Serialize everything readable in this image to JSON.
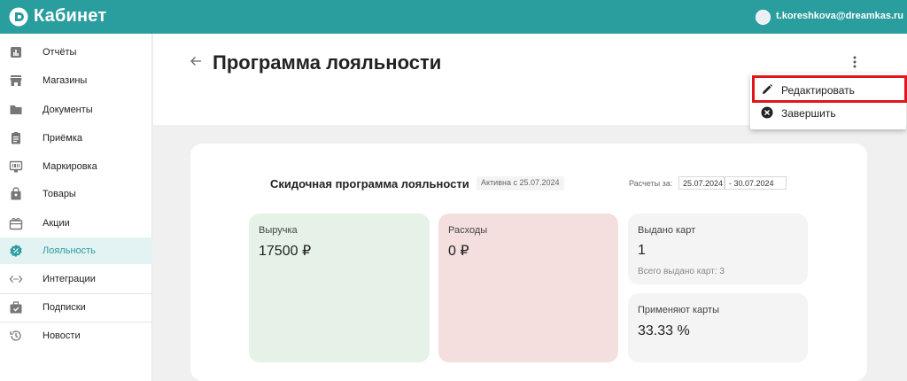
{
  "app": {
    "brand": "Кабинет",
    "user_email": "t.koreshkova@dreamkas.ru",
    "accent": "#2a9d9e"
  },
  "sidebar": {
    "items": [
      {
        "label": "Отчёты",
        "icon": "bar-chart-icon",
        "active": false
      },
      {
        "label": "Магазины",
        "icon": "store-icon",
        "active": false
      },
      {
        "label": "Документы",
        "icon": "folder-icon",
        "active": false
      },
      {
        "label": "Приёмка",
        "icon": "clipboard-icon",
        "active": false
      },
      {
        "label": "Маркировка",
        "icon": "barcode-scanner-icon",
        "active": false
      },
      {
        "label": "Товары",
        "icon": "shopping-bag-icon",
        "active": false
      },
      {
        "label": "Акции",
        "icon": "gift-icon",
        "active": false
      },
      {
        "label": "Лояльность",
        "icon": "badge-percent-icon",
        "active": true
      },
      {
        "label": "Интеграции",
        "icon": "code-arrows-icon",
        "active": false
      },
      {
        "label": "Подписки",
        "icon": "briefcase-check-icon",
        "active": false
      },
      {
        "label": "Новости",
        "icon": "history-icon",
        "active": false
      }
    ]
  },
  "page": {
    "title": "Программа лояльности"
  },
  "program": {
    "title": "Скидочная программа лояльности",
    "status": "Активна с 25.07.2024",
    "calc_label": "Расчеты за:",
    "date_from": "25.07.2024",
    "date_to": "- 30.07.2024"
  },
  "tiles": {
    "revenue": {
      "label": "Выручка",
      "value": "17500 ₽"
    },
    "expenses": {
      "label": "Расходы",
      "value": "0 ₽"
    },
    "cards_issued": {
      "label": "Выдано карт",
      "value": "1",
      "sub": "Всего выдано карт: 3"
    },
    "cards_usage": {
      "label": "Применяют карты",
      "value": "33.33 %"
    }
  },
  "menu": {
    "edit_label": "Редактировать",
    "finish_label": "Завершить"
  }
}
